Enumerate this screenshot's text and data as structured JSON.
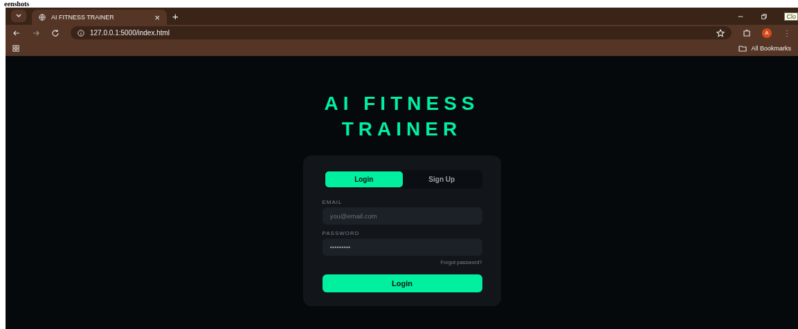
{
  "document_heading": "eenshots",
  "browser": {
    "tab": {
      "title": "AI FITNESS TRAINER",
      "close": "×",
      "new_tab": "+"
    },
    "tooltip": "Clo",
    "address": "127.0.0.1:5000/index.html",
    "profile": "A",
    "bookmarks": "All Bookmarks"
  },
  "page": {
    "title_lines": [
      "AI FITNESS",
      "TRAINER"
    ],
    "tabs": [
      {
        "label": "Login",
        "selected": true
      },
      {
        "label": "Sign Up",
        "selected": false
      }
    ],
    "fields": [
      {
        "label": "EMAIL",
        "placeholder": "you@email.com"
      },
      {
        "label": "PASSWORD",
        "value": "•••••••••"
      }
    ],
    "forgot_link": "Forgot password?",
    "submit": "Login"
  }
}
